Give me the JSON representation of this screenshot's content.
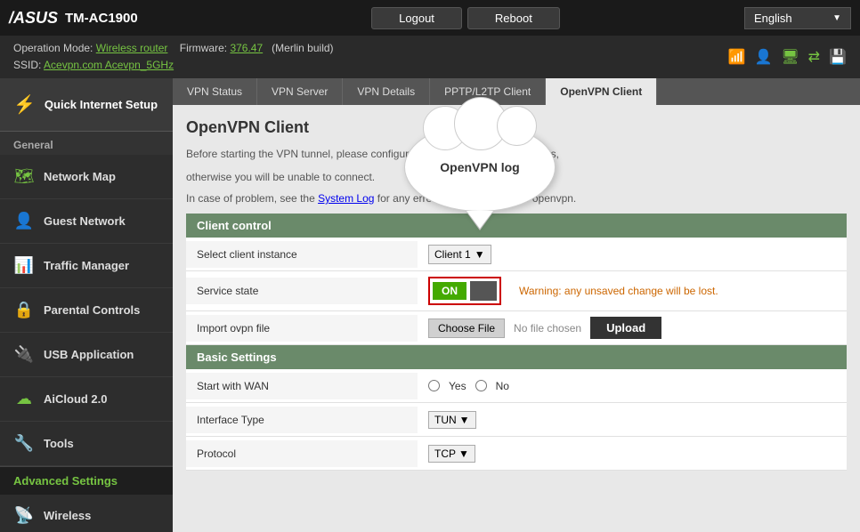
{
  "header": {
    "brand": "/ASUS",
    "model": "TM-AC1900",
    "buttons": {
      "logout": "Logout",
      "reboot": "Reboot"
    },
    "language": "English"
  },
  "subheader": {
    "operation_mode_label": "Operation Mode:",
    "operation_mode_value": "Wireless router",
    "firmware_label": "Firmware:",
    "firmware_value": "376.47",
    "build_label": "(Merlin build)",
    "ssid_label": "SSID:",
    "ssid_values": "Acevpn.com  Acevpn_5GHz"
  },
  "sidebar": {
    "quick_setup_label": "Quick Internet Setup",
    "general_label": "General",
    "items": [
      {
        "id": "network-map",
        "label": "Network Map",
        "icon": "🗺"
      },
      {
        "id": "guest-network",
        "label": "Guest Network",
        "icon": "👤"
      },
      {
        "id": "traffic-manager",
        "label": "Traffic Manager",
        "icon": "📊"
      },
      {
        "id": "parental-controls",
        "label": "Parental Controls",
        "icon": "🔒"
      },
      {
        "id": "usb-application",
        "label": "USB Application",
        "icon": "🔌"
      },
      {
        "id": "aicloud",
        "label": "AiCloud 2.0",
        "icon": "☁"
      },
      {
        "id": "tools",
        "label": "Tools",
        "icon": "🔧"
      }
    ],
    "advanced_settings_label": "Advanced Settings",
    "wireless_label": "Wireless"
  },
  "vpn_tabs": [
    {
      "id": "vpn-status",
      "label": "VPN Status"
    },
    {
      "id": "vpn-server",
      "label": "VPN Server"
    },
    {
      "id": "vpn-details",
      "label": "VPN Details"
    },
    {
      "id": "pptp-l2tp",
      "label": "PPTP/L2TP Client"
    },
    {
      "id": "openvpn-client",
      "label": "OpenVPN Client",
      "active": true
    }
  ],
  "content": {
    "page_title": "OpenVPN Client",
    "description1": "Before starting the VPN tunnel, please configure it, including the required keys,",
    "description2": "otherwise you will be unable to connect.",
    "system_log_text": "System Log",
    "warning_note": "In case of problem, see the System Log for any error message related to openvpn.",
    "speech_bubble_text": "OpenVPN log",
    "client_control": {
      "section_label": "Client control",
      "select_instance_label": "Select client instance",
      "select_instance_value": "Client 1",
      "service_state_label": "Service state",
      "toggle_on": "ON",
      "toggle_warning": "Warning: any unsaved change will be lost.",
      "import_ovpn_label": "Import ovpn file",
      "choose_file_label": "Choose File",
      "no_file_text": "No file chosen",
      "upload_label": "Upload"
    },
    "basic_settings": {
      "section_label": "Basic Settings",
      "start_with_wan_label": "Start with WAN",
      "yes_label": "Yes",
      "no_label": "No",
      "interface_type_label": "Interface Type",
      "interface_value": "TUN",
      "protocol_label": "Protocol",
      "protocol_value": "TCP"
    }
  }
}
